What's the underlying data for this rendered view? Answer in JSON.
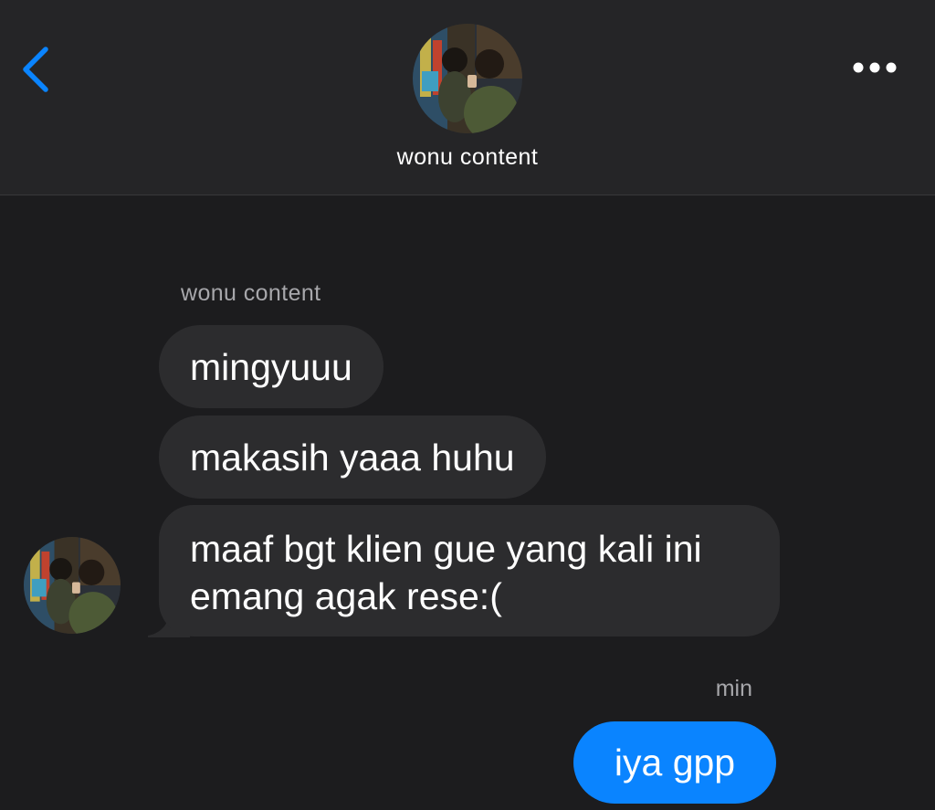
{
  "header": {
    "contact_name": "wonu content",
    "back_icon": "chevron-left-icon",
    "more_icon": "more-horizontal-icon",
    "accent_color": "#0a84ff"
  },
  "conversation": {
    "incoming_sender": "wonu content",
    "incoming_messages": [
      "mingyuuu",
      "makasih yaaa huhu",
      "maaf bgt klien gue yang kali ini emang agak rese:("
    ],
    "outgoing_sender": "min",
    "outgoing_messages": [
      "iya gpp"
    ],
    "incoming_bubble_color": "#2c2c2e",
    "outgoing_bubble_color": "#0a84ff"
  }
}
